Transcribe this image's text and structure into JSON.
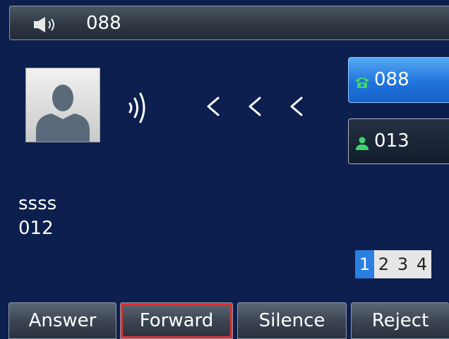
{
  "status_bar": {
    "icon": "speaker-icon",
    "number": "088"
  },
  "incoming_call": {
    "avatar_icon": "person-avatar-icon",
    "ring_icon": "ringing-waves-icon",
    "direction_icons": [
      "chevron-left-icon",
      "chevron-left-icon",
      "chevron-left-icon"
    ],
    "caller_name": "ssss",
    "caller_number": "012"
  },
  "line_keys": [
    {
      "label": "088",
      "icon": "phone-icon",
      "icon_color": "#3fd46a",
      "selected": true
    },
    {
      "label": "013",
      "icon": "contact-icon",
      "icon_color": "#3fd46a",
      "selected": false
    }
  ],
  "pagination": {
    "pages": [
      "1",
      "2",
      "3",
      "4"
    ],
    "active_page": "1"
  },
  "softkeys": {
    "answer": "Answer",
    "forward": "Forward",
    "silence": "Silence",
    "reject": "Reject",
    "highlighted": "forward",
    "highlight_color": "#e2302e"
  },
  "colors": {
    "background": "#0c1f4e",
    "selected_line": "#1f74dc",
    "active_page": "#2a7fe0"
  }
}
